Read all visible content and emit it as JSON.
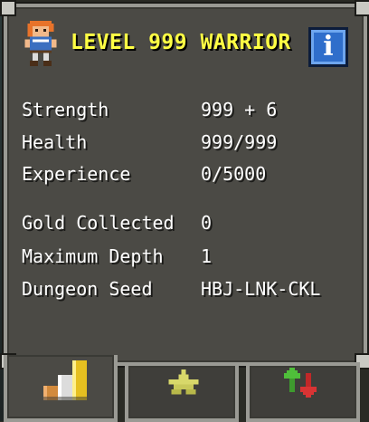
{
  "header": {
    "title": "LEVEL 999 WARRIOR",
    "info_label": "i"
  },
  "stats": [
    {
      "label": "Strength",
      "value": "999 + 6"
    },
    {
      "label": "Health",
      "value": "999/999"
    },
    {
      "label": "Experience",
      "value": "0/5000"
    },
    {
      "label": "Gold Collected",
      "value": "0"
    },
    {
      "label": "Maximum Depth",
      "value": "1"
    },
    {
      "label": "Dungeon Seed",
      "value": "HBJ-LNK-CKL"
    }
  ],
  "tabs": [
    {
      "icon": "bar-chart-icon",
      "active": true
    },
    {
      "icon": "star-icon",
      "active": false
    },
    {
      "icon": "up-down-arrows-icon",
      "active": false
    }
  ],
  "colors": {
    "title": "#ffff44",
    "panel": "#4b4a45",
    "border": "#9a9a94",
    "info_button": "#2f6ecb"
  }
}
